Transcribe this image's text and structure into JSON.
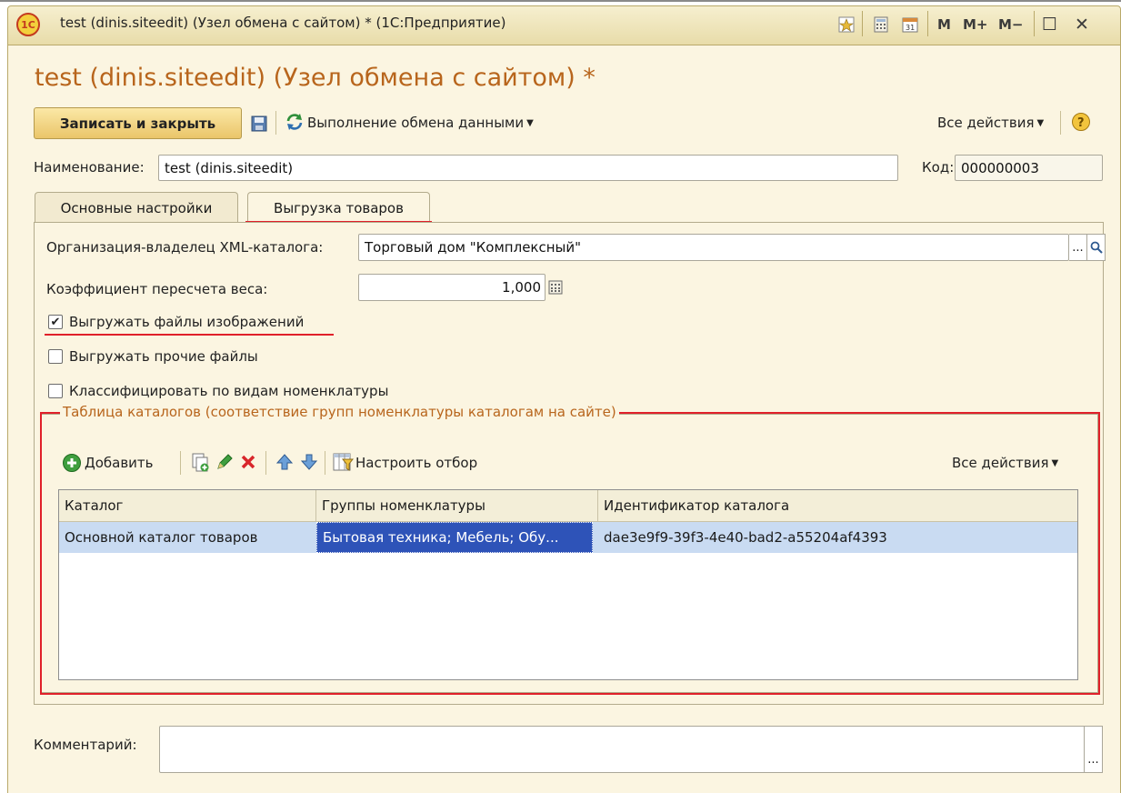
{
  "window": {
    "title": "test (dinis.siteedit) (Узел обмена с сайтом) * (1С:Предприятие)",
    "logo_text": "1C",
    "buttons": {
      "m": "M",
      "mplus": "M+",
      "mminus": "M−",
      "maximize": "☐",
      "close": "✕"
    }
  },
  "form": {
    "title": "test (dinis.siteedit) (Узел обмена с сайтом) *",
    "toolbar": {
      "save_close": "Записать и закрыть",
      "exchange": "Выполнение обмена данными",
      "all_actions": "Все действия"
    },
    "name_label": "Наименование:",
    "name_value": "test (dinis.siteedit)",
    "code_label": "Код:",
    "code_value": "000000003"
  },
  "tabs": [
    {
      "label": "Основные настройки",
      "active": false
    },
    {
      "label": "Выгрузка товаров",
      "active": true
    }
  ],
  "export": {
    "org_label": "Организация-владелец XML-каталога:",
    "org_value": "Торговый дом \"Комплексный\"",
    "org_choose": "...",
    "weight_label": "Коэффициент пересчета веса:",
    "weight_value": "1,000",
    "checkboxes": [
      {
        "label": "Выгружать файлы изображений",
        "checked": true
      },
      {
        "label": "Выгружать прочие файлы",
        "checked": false
      },
      {
        "label": "Классифицировать по видам номенклатуры",
        "checked": false
      }
    ]
  },
  "catalog_table": {
    "legend": "Таблица каталогов (соответствие групп номенклатуры каталогам на сайте)",
    "add_label": "Добавить",
    "filter_label": "Настроить отбор",
    "all_actions": "Все действия",
    "columns": [
      "Каталог",
      "Группы номенклатуры",
      "Идентификатор каталога"
    ],
    "rows": [
      {
        "catalog": "Основной каталог товаров",
        "groups": "Бытовая техника; Мебель; Обу...",
        "id": "dae3e9f9-39f3-4e40-bad2-a55204af4393"
      }
    ]
  },
  "comment": {
    "label": "Комментарий:",
    "value": "",
    "choose": "..."
  },
  "colors": {
    "accent_title": "#b8651c",
    "highlight": "#e0202a",
    "selection": "#2e53b8"
  }
}
